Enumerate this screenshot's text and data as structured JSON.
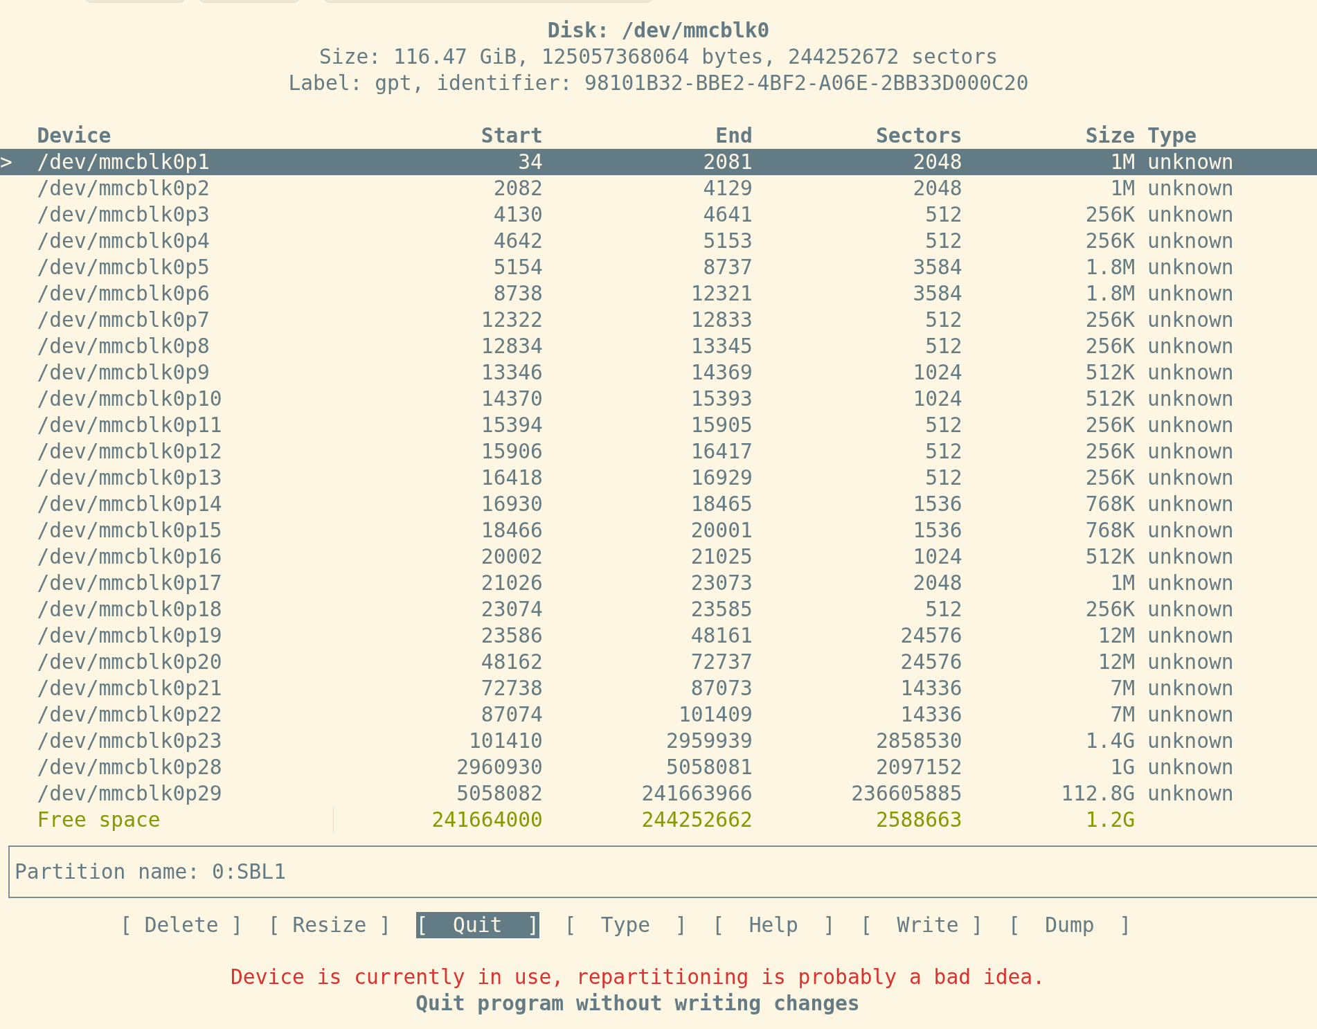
{
  "disk": {
    "title": "Disk: /dev/mmcblk0",
    "size_line": "Size: 116.47 GiB, 125057368064 bytes, 244252672 sectors",
    "label_line": "Label: gpt, identifier: 98101B32-BBE2-4BF2-A06E-2BB33D000C20"
  },
  "table": {
    "cursor": ">",
    "columns": [
      "Device",
      "Start",
      "End",
      "Sectors",
      "Size",
      "Type"
    ],
    "rows": [
      {
        "kind": "partition",
        "selected": true,
        "device": "/dev/mmcblk0p1",
        "start": "34",
        "end": "2081",
        "sectors": "2048",
        "size": "1M",
        "type": "unknown"
      },
      {
        "kind": "partition",
        "selected": false,
        "device": "/dev/mmcblk0p2",
        "start": "2082",
        "end": "4129",
        "sectors": "2048",
        "size": "1M",
        "type": "unknown"
      },
      {
        "kind": "partition",
        "selected": false,
        "device": "/dev/mmcblk0p3",
        "start": "4130",
        "end": "4641",
        "sectors": "512",
        "size": "256K",
        "type": "unknown"
      },
      {
        "kind": "partition",
        "selected": false,
        "device": "/dev/mmcblk0p4",
        "start": "4642",
        "end": "5153",
        "sectors": "512",
        "size": "256K",
        "type": "unknown"
      },
      {
        "kind": "partition",
        "selected": false,
        "device": "/dev/mmcblk0p5",
        "start": "5154",
        "end": "8737",
        "sectors": "3584",
        "size": "1.8M",
        "type": "unknown"
      },
      {
        "kind": "partition",
        "selected": false,
        "device": "/dev/mmcblk0p6",
        "start": "8738",
        "end": "12321",
        "sectors": "3584",
        "size": "1.8M",
        "type": "unknown"
      },
      {
        "kind": "partition",
        "selected": false,
        "device": "/dev/mmcblk0p7",
        "start": "12322",
        "end": "12833",
        "sectors": "512",
        "size": "256K",
        "type": "unknown"
      },
      {
        "kind": "partition",
        "selected": false,
        "device": "/dev/mmcblk0p8",
        "start": "12834",
        "end": "13345",
        "sectors": "512",
        "size": "256K",
        "type": "unknown"
      },
      {
        "kind": "partition",
        "selected": false,
        "device": "/dev/mmcblk0p9",
        "start": "13346",
        "end": "14369",
        "sectors": "1024",
        "size": "512K",
        "type": "unknown"
      },
      {
        "kind": "partition",
        "selected": false,
        "device": "/dev/mmcblk0p10",
        "start": "14370",
        "end": "15393",
        "sectors": "1024",
        "size": "512K",
        "type": "unknown"
      },
      {
        "kind": "partition",
        "selected": false,
        "device": "/dev/mmcblk0p11",
        "start": "15394",
        "end": "15905",
        "sectors": "512",
        "size": "256K",
        "type": "unknown"
      },
      {
        "kind": "partition",
        "selected": false,
        "device": "/dev/mmcblk0p12",
        "start": "15906",
        "end": "16417",
        "sectors": "512",
        "size": "256K",
        "type": "unknown"
      },
      {
        "kind": "partition",
        "selected": false,
        "device": "/dev/mmcblk0p13",
        "start": "16418",
        "end": "16929",
        "sectors": "512",
        "size": "256K",
        "type": "unknown"
      },
      {
        "kind": "partition",
        "selected": false,
        "device": "/dev/mmcblk0p14",
        "start": "16930",
        "end": "18465",
        "sectors": "1536",
        "size": "768K",
        "type": "unknown"
      },
      {
        "kind": "partition",
        "selected": false,
        "device": "/dev/mmcblk0p15",
        "start": "18466",
        "end": "20001",
        "sectors": "1536",
        "size": "768K",
        "type": "unknown"
      },
      {
        "kind": "partition",
        "selected": false,
        "device": "/dev/mmcblk0p16",
        "start": "20002",
        "end": "21025",
        "sectors": "1024",
        "size": "512K",
        "type": "unknown"
      },
      {
        "kind": "partition",
        "selected": false,
        "device": "/dev/mmcblk0p17",
        "start": "21026",
        "end": "23073",
        "sectors": "2048",
        "size": "1M",
        "type": "unknown"
      },
      {
        "kind": "partition",
        "selected": false,
        "device": "/dev/mmcblk0p18",
        "start": "23074",
        "end": "23585",
        "sectors": "512",
        "size": "256K",
        "type": "unknown"
      },
      {
        "kind": "partition",
        "selected": false,
        "device": "/dev/mmcblk0p19",
        "start": "23586",
        "end": "48161",
        "sectors": "24576",
        "size": "12M",
        "type": "unknown"
      },
      {
        "kind": "partition",
        "selected": false,
        "device": "/dev/mmcblk0p20",
        "start": "48162",
        "end": "72737",
        "sectors": "24576",
        "size": "12M",
        "type": "unknown"
      },
      {
        "kind": "partition",
        "selected": false,
        "device": "/dev/mmcblk0p21",
        "start": "72738",
        "end": "87073",
        "sectors": "14336",
        "size": "7M",
        "type": "unknown"
      },
      {
        "kind": "partition",
        "selected": false,
        "device": "/dev/mmcblk0p22",
        "start": "87074",
        "end": "101409",
        "sectors": "14336",
        "size": "7M",
        "type": "unknown"
      },
      {
        "kind": "partition",
        "selected": false,
        "device": "/dev/mmcblk0p23",
        "start": "101410",
        "end": "2959939",
        "sectors": "2858530",
        "size": "1.4G",
        "type": "unknown"
      },
      {
        "kind": "partition",
        "selected": false,
        "device": "/dev/mmcblk0p28",
        "start": "2960930",
        "end": "5058081",
        "sectors": "2097152",
        "size": "1G",
        "type": "unknown"
      },
      {
        "kind": "partition",
        "selected": false,
        "device": "/dev/mmcblk0p29",
        "start": "5058082",
        "end": "241663966",
        "sectors": "236605885",
        "size": "112.8G",
        "type": "unknown"
      },
      {
        "kind": "free",
        "selected": false,
        "device": "Free space",
        "start": "241664000",
        "end": "244252662",
        "sectors": "2588663",
        "size": "1.2G"
      }
    ]
  },
  "info_line": "Partition name: 0:SBL1",
  "buttons": [
    {
      "label": "[ Delete ]",
      "selected": false
    },
    {
      "label": "[ Resize ]",
      "selected": false
    },
    {
      "label": "[  Quit  ]",
      "selected": true
    },
    {
      "label": "[  Type  ]",
      "selected": false
    },
    {
      "label": "[  Help  ]",
      "selected": false
    },
    {
      "label": "[  Write ]",
      "selected": false
    },
    {
      "label": "[  Dump  ]",
      "selected": false
    }
  ],
  "warning": "Device is currently in use, repartitioning is probably a bad idea.",
  "hint": "Quit program without writing changes"
}
